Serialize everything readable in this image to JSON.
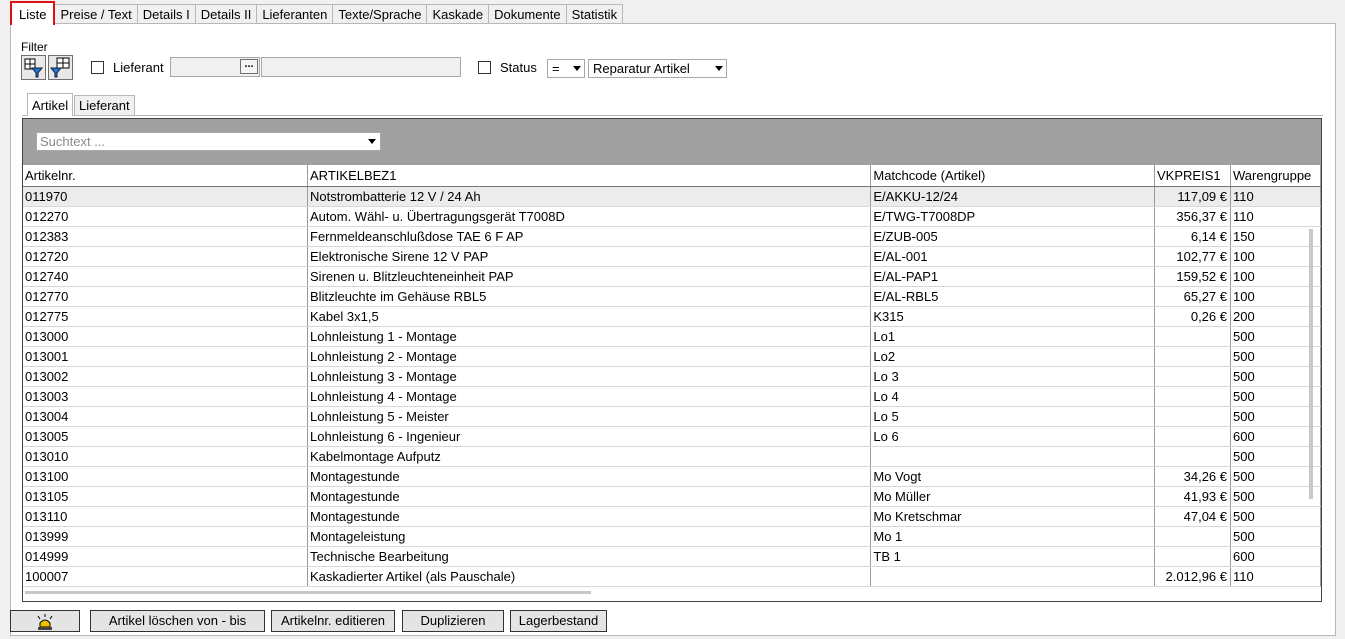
{
  "tabs": [
    {
      "label": "Liste",
      "active": true
    },
    {
      "label": "Preise / Text"
    },
    {
      "label": "Details I"
    },
    {
      "label": "Details II"
    },
    {
      "label": "Lieferanten"
    },
    {
      "label": "Texte/Sprache"
    },
    {
      "label": "Kaskade"
    },
    {
      "label": "Dokumente"
    },
    {
      "label": "Statistik"
    }
  ],
  "filter": {
    "title": "Filter",
    "lieferant_label": "Lieferant",
    "status_label": "Status",
    "status_operator": "=",
    "status_value": "Reparatur Artikel",
    "lieferant_button": "..."
  },
  "subtabs": [
    {
      "label": "Artikel",
      "active": true
    },
    {
      "label": "Lieferant"
    }
  ],
  "search": {
    "placeholder": "Suchtext ..."
  },
  "grid": {
    "columns": [
      "Artikelnr.",
      "ARTIKELBEZ1",
      "Matchcode (Artikel)",
      "VKPREIS1",
      "Warengruppe"
    ],
    "rows": [
      [
        "011970",
        "Notstrombatterie 12 V / 24 Ah",
        "E/AKKU-12/24",
        "117,09 €",
        "110"
      ],
      [
        "012270",
        "Autom. Wähl- u. Übertragungsgerät T7008D",
        "E/TWG-T7008DP",
        "356,37 €",
        "110"
      ],
      [
        "012383",
        "Fernmeldeanschlußdose TAE 6 F AP",
        "E/ZUB-005",
        "6,14 €",
        "150"
      ],
      [
        "012720",
        "Elektronische Sirene 12 V PAP",
        "E/AL-001",
        "102,77 €",
        "100"
      ],
      [
        "012740",
        "Sirenen u. Blitzleuchteneinheit PAP",
        "E/AL-PAP1",
        "159,52 €",
        "100"
      ],
      [
        "012770",
        "Blitzleuchte im Gehäuse RBL5",
        "E/AL-RBL5",
        "65,27 €",
        "100"
      ],
      [
        "012775",
        "Kabel 3x1,5",
        "K315",
        "0,26 €",
        "200"
      ],
      [
        "013000",
        "Lohnleistung 1 - Montage",
        "Lo1",
        "",
        "500"
      ],
      [
        "013001",
        "Lohnleistung 2 - Montage",
        "Lo2",
        "",
        "500"
      ],
      [
        "013002",
        "Lohnleistung 3 - Montage",
        "Lo 3",
        "",
        "500"
      ],
      [
        "013003",
        "Lohnleistung 4 - Montage",
        "Lo 4",
        "",
        "500"
      ],
      [
        "013004",
        "Lohnleistung 5 - Meister",
        "Lo 5",
        "",
        "500"
      ],
      [
        "013005",
        "Lohnleistung 6 - Ingenieur",
        "Lo 6",
        "",
        "600"
      ],
      [
        "013010",
        "Kabelmontage Aufputz",
        "",
        "",
        "500"
      ],
      [
        "013100",
        "Montagestunde",
        "Mo Vogt",
        "34,26 €",
        "500"
      ],
      [
        "013105",
        "Montagestunde",
        "Mo Müller",
        "41,93 €",
        "500"
      ],
      [
        "013110",
        "Montagestunde",
        "Mo Kretschmar",
        "47,04 €",
        "500"
      ],
      [
        "013999",
        "Montageleistung",
        "Mo 1",
        "",
        "500"
      ],
      [
        "014999",
        "Technische Bearbeitung",
        "TB 1",
        "",
        "600"
      ],
      [
        "100007",
        "Kaskadierter Artikel (als Pauschale)",
        "",
        "2.012,96 €",
        "110"
      ]
    ]
  },
  "buttons": {
    "alarm_icon": "alarm-light-icon",
    "delete": "Artikel löschen von - bis",
    "edit": "Artikelnr. editieren",
    "duplicate": "Duplizieren",
    "stock": "Lagerbestand"
  }
}
